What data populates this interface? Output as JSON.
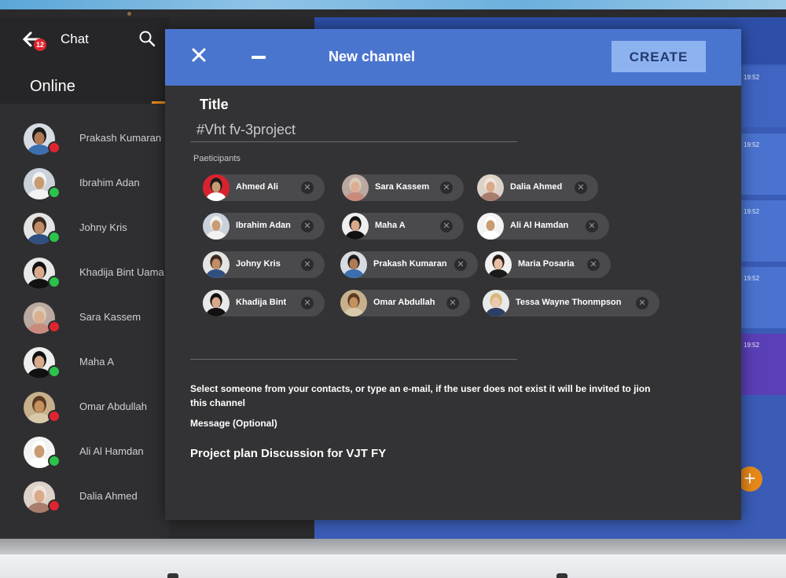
{
  "chat_panel": {
    "title": "Chat",
    "notification_count": "12",
    "section": "Online",
    "contacts": [
      {
        "name": "Prakash Kumaran",
        "status": "busy",
        "skin": "#b07a55",
        "shirt": "#3b6fb0",
        "hair": "#1b1b1b",
        "bg": "#d7dce2"
      },
      {
        "name": "Ibrahim Adan",
        "status": "online",
        "skin": "#c89b72",
        "shirt": "#f2f2f2",
        "hair": "#f2f2f2",
        "bg": "#c9d1da"
      },
      {
        "name": "Johny Kris",
        "status": "online",
        "skin": "#c18d66",
        "shirt": "#2f4f7f",
        "hair": "#3a2a1f",
        "bg": "#e4e4e4"
      },
      {
        "name": "Khadija Bint Uama",
        "status": "online",
        "skin": "#d9a98a",
        "shirt": "#111111",
        "hair": "#111111",
        "bg": "#e8e8e8"
      },
      {
        "name": "Sara Kassem",
        "status": "busy",
        "skin": "#dcae90",
        "shirt": "#c98a7e",
        "hair": "#d9c9b8",
        "bg": "#b9a9a0"
      },
      {
        "name": "Maha A",
        "status": "online",
        "skin": "#d8a98b",
        "shirt": "#111111",
        "hair": "#111111",
        "bg": "#efefef"
      },
      {
        "name": "Omar Abdullah",
        "status": "busy",
        "skin": "#c4915f",
        "shirt": "#d8c9ab",
        "hair": "#5b3b22",
        "bg": "#c7b08b"
      },
      {
        "name": "Ali Al Hamdan",
        "status": "online",
        "skin": "#c99b72",
        "shirt": "#ffffff",
        "hair": "#ffffff",
        "bg": "#f3f3f3"
      },
      {
        "name": "Dalia Ahmed",
        "status": "busy",
        "skin": "#d9a98a",
        "shirt": "#a97d6d",
        "hair": "#efe4dc",
        "bg": "#ddd2c8"
      }
    ]
  },
  "status_colors": {
    "online": "#2cc34a",
    "busy": "#e0242f"
  },
  "timeline": [
    "19:52",
    "19:52",
    "19:52",
    "19:52",
    "19:52"
  ],
  "modal": {
    "title": "New channel",
    "create_label": "CREATE",
    "title_label": "Title",
    "title_value": "#Vht fv-3project",
    "participants_label": "Paeticipants",
    "participants": [
      {
        "name": "Ahmed Ali",
        "skin": "#c89b72",
        "hair": "#1b1b1b",
        "shirt": "#ffffff",
        "bg": "#d8232f"
      },
      {
        "name": "Sara Kassem",
        "skin": "#dcae90",
        "hair": "#d9c9b8",
        "shirt": "#c98a7e",
        "bg": "#b9a9a0"
      },
      {
        "name": "Dalia Ahmed",
        "skin": "#d9a98a",
        "hair": "#efe4dc",
        "shirt": "#a97d6d",
        "bg": "#ddd2c8"
      },
      {
        "name": "Ibrahim Adan",
        "skin": "#c89b72",
        "hair": "#f2f2f2",
        "shirt": "#f2f2f2",
        "bg": "#c9d1da"
      },
      {
        "name": "Maha A",
        "skin": "#d8a98b",
        "hair": "#111111",
        "shirt": "#111111",
        "bg": "#efefef"
      },
      {
        "name": "Ali Al Hamdan",
        "skin": "#c99b72",
        "hair": "#ffffff",
        "shirt": "#ffffff",
        "bg": "#f3f3f3"
      },
      {
        "name": "Johny Kris",
        "skin": "#c18d66",
        "hair": "#3a2a1f",
        "shirt": "#2f4f7f",
        "bg": "#e4e4e4"
      },
      {
        "name": "Prakash Kumaran",
        "skin": "#b07a55",
        "hair": "#1b1b1b",
        "shirt": "#3b6fb0",
        "bg": "#d7dce2"
      },
      {
        "name": "Maria Posaria",
        "skin": "#e6bfa5",
        "hair": "#2a1c14",
        "shirt": "#1a1a1a",
        "bg": "#f1f1f1"
      },
      {
        "name": "Khadija Bint",
        "skin": "#d9a98a",
        "hair": "#111111",
        "shirt": "#111111",
        "bg": "#e8e8e8"
      },
      {
        "name": "Omar Abdullah",
        "skin": "#c4915f",
        "hair": "#5b3b22",
        "shirt": "#d8c9ab",
        "bg": "#c7b08b"
      },
      {
        "name": "Tessa Wayne Thonmpson",
        "skin": "#ecc8ae",
        "hair": "#d8b878",
        "shirt": "#2b3e63",
        "bg": "#e9e9e9"
      }
    ],
    "hint": "Select someone from your contacts, or type an e-mail, if the user does not exist it will be invited to jion this channel",
    "message_label": "Message (Optional)",
    "message_value": "Project plan Discussion for VJT FY"
  }
}
